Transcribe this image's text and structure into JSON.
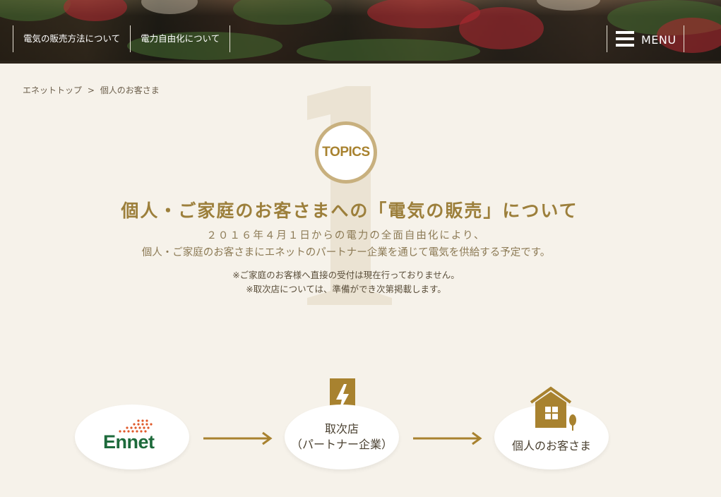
{
  "header": {
    "nav_items": [
      "電気の販売方法について",
      "電力自由化について"
    ],
    "menu_label": "MENU"
  },
  "breadcrumb": {
    "home": "エネットトップ",
    "separator": ">",
    "current": "個人のお客さま"
  },
  "topics_badge": "TOPICS",
  "title": "個人・ご家庭のお客さまへの「電気の販売」について",
  "lead": [
    "２０１６年４月１日からの電力の全面自由化により、",
    "個人・ご家庭のお客さまにエネットのパートナー企業を通じて電気を供給する予定です。"
  ],
  "notes": [
    "※ご家庭のお客様へ直接の受付は現在行っておりません。",
    "※取次店については、準備ができ次第掲載します。"
  ],
  "flow": {
    "ennet_logo": "Ennet",
    "agent_line1": "取次店",
    "agent_line2": "（パートナー企業）",
    "customer": "個人のお客さま"
  },
  "colors": {
    "accent_gold": "#a8822f",
    "title_gold": "#9c7f3b",
    "background": "#f6f2ea",
    "ennet_green": "#1d6a3b",
    "ennet_orange": "#e0592a"
  },
  "icons": [
    "hamburger-icon",
    "lightning-icon",
    "house-icon",
    "arrow-right-icon"
  ]
}
